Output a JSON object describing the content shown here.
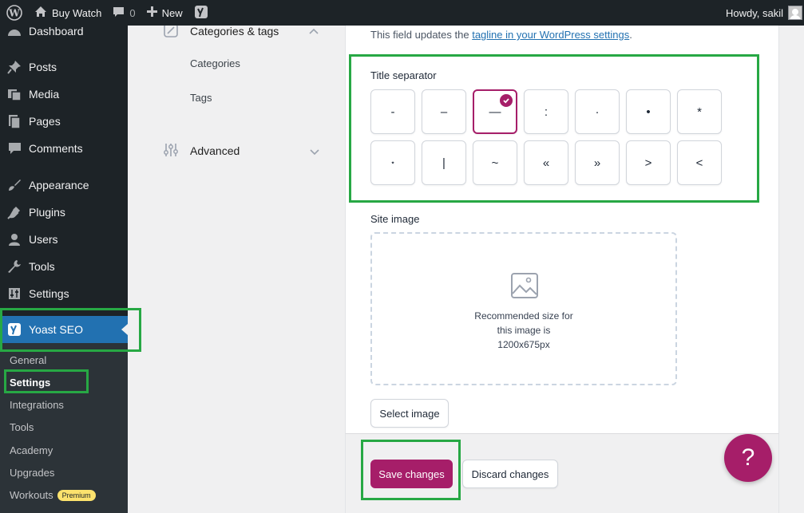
{
  "admin_bar": {
    "site_name": "Buy Watch",
    "comments_count": "0",
    "new_label": "New",
    "greeting": "Howdy, sakil"
  },
  "admin_menu": {
    "items": [
      {
        "label": "Dashboard",
        "icon": "dashboard-icon"
      },
      {
        "label": "Posts",
        "icon": "pushpin-icon"
      },
      {
        "label": "Media",
        "icon": "media-icon"
      },
      {
        "label": "Pages",
        "icon": "pages-icon"
      },
      {
        "label": "Comments",
        "icon": "comment-icon"
      },
      {
        "label": "Appearance",
        "icon": "paintbrush-icon"
      },
      {
        "label": "Plugins",
        "icon": "plugin-icon"
      },
      {
        "label": "Users",
        "icon": "user-icon"
      },
      {
        "label": "Tools",
        "icon": "wrench-icon"
      },
      {
        "label": "Settings",
        "icon": "settings-icon"
      },
      {
        "label": "Yoast SEO",
        "icon": "yoast-icon"
      }
    ],
    "submenu": [
      {
        "label": "General"
      },
      {
        "label": "Settings"
      },
      {
        "label": "Integrations"
      },
      {
        "label": "Tools"
      },
      {
        "label": "Academy"
      },
      {
        "label": "Upgrades"
      },
      {
        "label": "Workouts"
      }
    ],
    "premium_badge": "Premium"
  },
  "settings_nav": {
    "categories_tags": "Categories & tags",
    "categories": "Categories",
    "tags": "Tags",
    "advanced": "Advanced"
  },
  "main": {
    "tagline_prefix": "This field updates the ",
    "tagline_link": "tagline in your WordPress settings",
    "tagline_suffix": ".",
    "title_separator_label": "Title separator",
    "separators": [
      "-",
      "–",
      "—",
      ":",
      "·",
      "•",
      "*",
      "⋆",
      "|",
      "~",
      "«",
      "»",
      ">",
      "<"
    ],
    "selected_separator": "—",
    "site_image_label": "Site image",
    "image_hint_line1": "Recommended size for",
    "image_hint_line2": "this image is",
    "image_hint_line3": "1200x675px",
    "select_image": "Select image",
    "save_changes": "Save changes",
    "discard_changes": "Discard changes",
    "help": "?"
  },
  "colors": {
    "accent": "#a61e69",
    "wp_blue": "#2271b1",
    "highlight_green": "#27a844",
    "admin_dark": "#1d2327"
  }
}
